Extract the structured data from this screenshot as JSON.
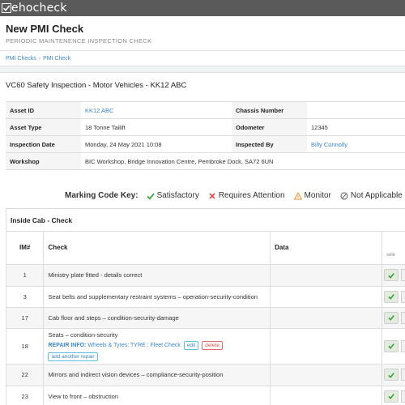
{
  "app": {
    "brand_prefix": "V",
    "brand_rest": "ehocheck"
  },
  "header": {
    "title": "New PMI Check",
    "subtitle": "PERIODIC MAINTENENCE INSPECTION CHECK"
  },
  "breadcrumb": [
    "PMI Checks",
    "PMI Check"
  ],
  "inspection": {
    "title": "VC60 Safety Inspection - Motor Vehicles - KK12 ABC",
    "asset_id_label": "Asset ID",
    "asset_id": "KK12 ABC",
    "chassis_label": "Chassis Number",
    "chassis": "",
    "asset_type_label": "Asset Type",
    "asset_type": "18 Tonne Tailift",
    "odometer_label": "Odometer",
    "odometer": "12345",
    "date_label": "Inspection Date",
    "date": "Monday, 24 May 2021 10:08",
    "inspected_by_label": "Inspected By",
    "inspected_by": "Billy Connolly",
    "workshop_label": "Workshop",
    "workshop": "BIC Workshop, Bridge Innovation Centre, Pembroke Dock, SA72 6UN"
  },
  "legend": {
    "key_label": "Marking Code Key:",
    "satisfactory": "Satisfactory",
    "requires_attention": "Requires Attention",
    "monitor": "Monitor",
    "not_applicable": "Not Applicable",
    "colors": {
      "satisfactory": "#3aa33a",
      "requires_attention": "#d9534f",
      "monitor": "#e8912d",
      "not_applicable": "#777777"
    }
  },
  "section": {
    "title": "Inside Cab - Check",
    "columns": {
      "im": "IM#",
      "check": "Check",
      "data": "Data",
      "select": "sele"
    },
    "rows": [
      {
        "im": "1",
        "check": "Ministry plate fitted - details correct"
      },
      {
        "im": "3",
        "check": "Seat belts and supplementary restraint systems – operation-security-condition"
      },
      {
        "im": "17",
        "check": "Cab floor and steps – condition-security-damage"
      },
      {
        "im": "18",
        "check": "Seats – condition-security"
      },
      {
        "im": "22",
        "check": "Mirrors and indirect vision devices – compliance-security-position"
      },
      {
        "im": "23",
        "check": "View to front – obstruction"
      }
    ],
    "repair": {
      "label": "REPAIR INFO:",
      "text": "Wheels & Tyres: TYRE : Fleet Check",
      "edit": "edit",
      "delete": "delete",
      "add": "add another repair"
    }
  }
}
